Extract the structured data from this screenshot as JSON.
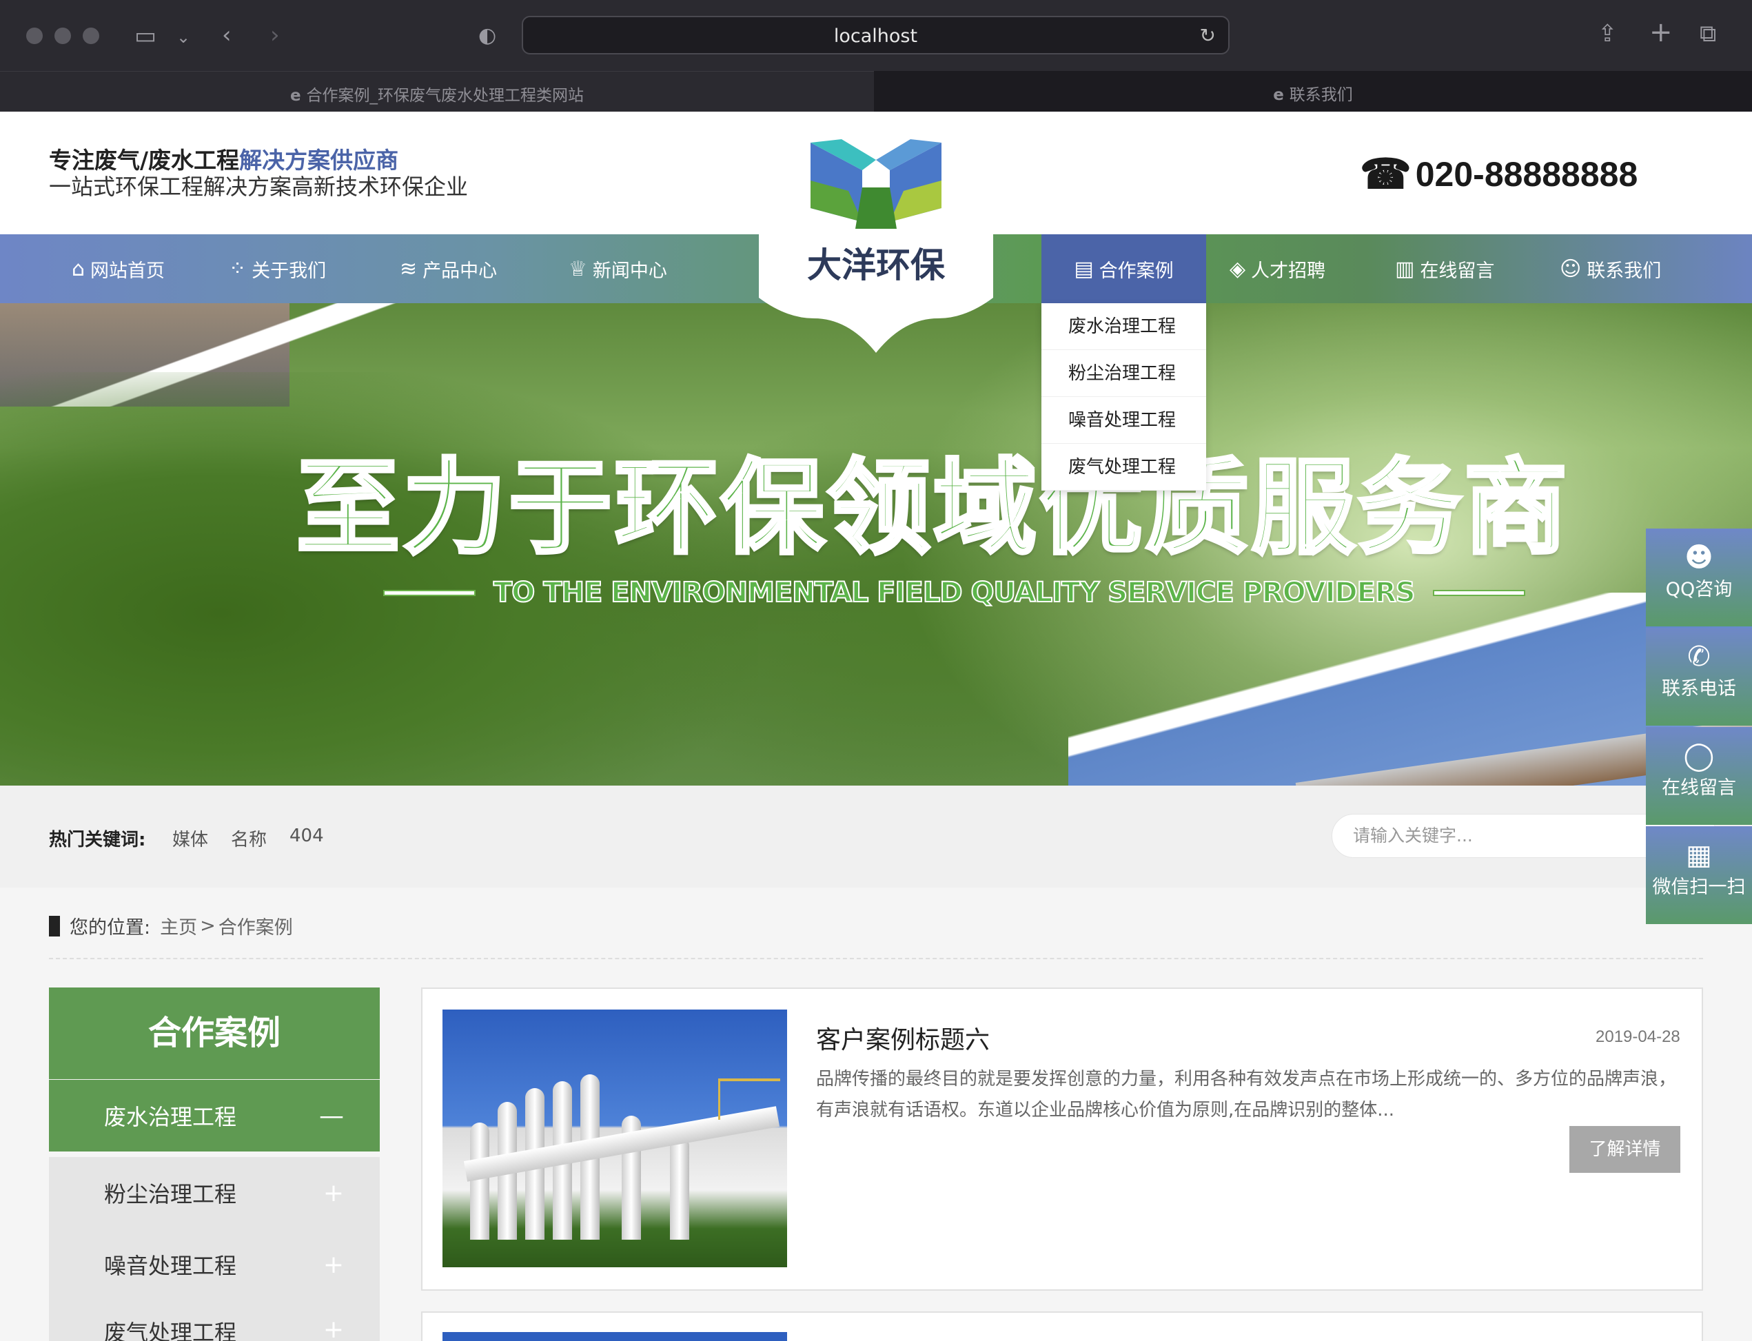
{
  "browser": {
    "url": "localhost",
    "tabs": [
      {
        "label": "合作案例_环保废气废水处理工程类网站"
      },
      {
        "label": "联系我们"
      }
    ]
  },
  "header": {
    "slogan_part1": "专注废气/废水工程",
    "slogan_part2": "解决方案供应商",
    "slogan_line2": "一站式环保工程解决方案高新技术环保企业",
    "phone": "020-88888888",
    "logo_text": "大洋环保"
  },
  "nav": {
    "items": [
      {
        "label": "网站首页",
        "icon": "home-icon"
      },
      {
        "label": "关于我们",
        "icon": "grid-icon"
      },
      {
        "label": "产品中心",
        "icon": "layers-icon"
      },
      {
        "label": "新闻中心",
        "icon": "trophy-icon"
      },
      {
        "label": "合作案例",
        "icon": "document-icon"
      },
      {
        "label": "人才招聘",
        "icon": "handshake-icon"
      },
      {
        "label": "在线留言",
        "icon": "form-icon"
      },
      {
        "label": "联系我们",
        "icon": "user-icon"
      }
    ],
    "dropdown": [
      "废水治理工程",
      "粉尘治理工程",
      "噪音处理工程",
      "废气处理工程"
    ]
  },
  "banner": {
    "title": "至力于环保领域优质服务商",
    "subtitle": "TO THE ENVIRONMENTAL FIELD QUALITY SERVICE PROVIDERS"
  },
  "search": {
    "hot_label": "热门关键词:",
    "keywords": [
      "媒体",
      "名称",
      "404"
    ],
    "placeholder": "请输入关键字..."
  },
  "breadcrumb": {
    "label": "您的位置:",
    "home": "主页",
    "sep": ">",
    "current": "合作案例"
  },
  "sidebar": {
    "title": "合作案例",
    "items": [
      {
        "label": "废水治理工程",
        "sign": "—"
      },
      {
        "label": "粉尘治理工程",
        "sign": "+"
      },
      {
        "label": "噪音处理工程",
        "sign": "+"
      },
      {
        "label": "废气处理工程",
        "sign": "+"
      }
    ]
  },
  "cases": [
    {
      "title": "客户案例标题六",
      "date": "2019-04-28",
      "desc": "品牌传播的最终目的就是要发挥创意的力量，利用各种有效发声点在市场上形成统一的、多方位的品牌声浪，有声浪就有话语权。东道以企业品牌核心价值为原则,在品牌识别的整体...",
      "more": "了解详情"
    }
  ],
  "floating": [
    {
      "label": "QQ咨询",
      "icon": "qq-icon"
    },
    {
      "label": "联系电话",
      "icon": "phone-icon"
    },
    {
      "label": "在线留言",
      "icon": "chat-icon"
    },
    {
      "label": "微信扫一扫",
      "icon": "qrcode-icon"
    }
  ],
  "colors": {
    "nav_active": "#4b64a8",
    "green": "#5f9a52",
    "accent_blue": "#4b64a8"
  }
}
